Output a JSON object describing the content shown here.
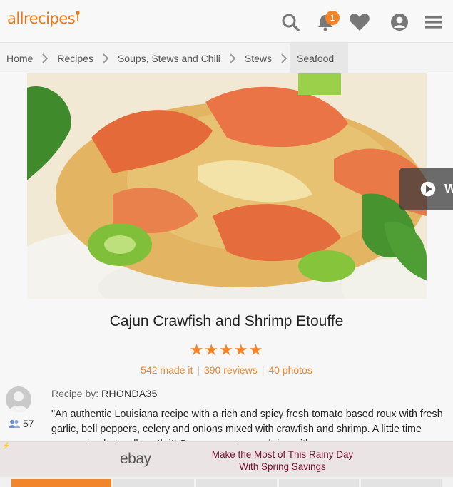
{
  "header": {
    "logo": "allrecipes",
    "notification_count": "1",
    "icons": [
      "search-icon",
      "bell-icon",
      "heart-icon",
      "profile-icon",
      "menu-icon"
    ]
  },
  "breadcrumb": [
    "Home",
    "Recipes",
    "Soups, Stews and Chili",
    "Stews",
    "Seafood"
  ],
  "video_label": "W",
  "recipe": {
    "title": "Cajun Crawfish and Shrimp Etouffe",
    "rating": 5,
    "stars": "★★★★★",
    "made_it": "542 made it",
    "reviews": "390 reviews",
    "photos": "40 photos",
    "by_label": "Recipe by:",
    "author": "RHONDA35",
    "made_count": "57",
    "description": "\"An authentic Louisiana recipe with a rich and spicy fresh tomato based roux with fresh garlic, bell peppers, celery and onions mixed with crawfish and shrimp. A little time consuming but well worth it! Serve over steamed rice with"
  },
  "ad": {
    "brand": "ebay",
    "line1": "Make the Most of This Rainy Day",
    "line2": "With Spring Savings"
  },
  "colors": {
    "accent": "#f2842a",
    "ad_text": "#7a1332"
  }
}
